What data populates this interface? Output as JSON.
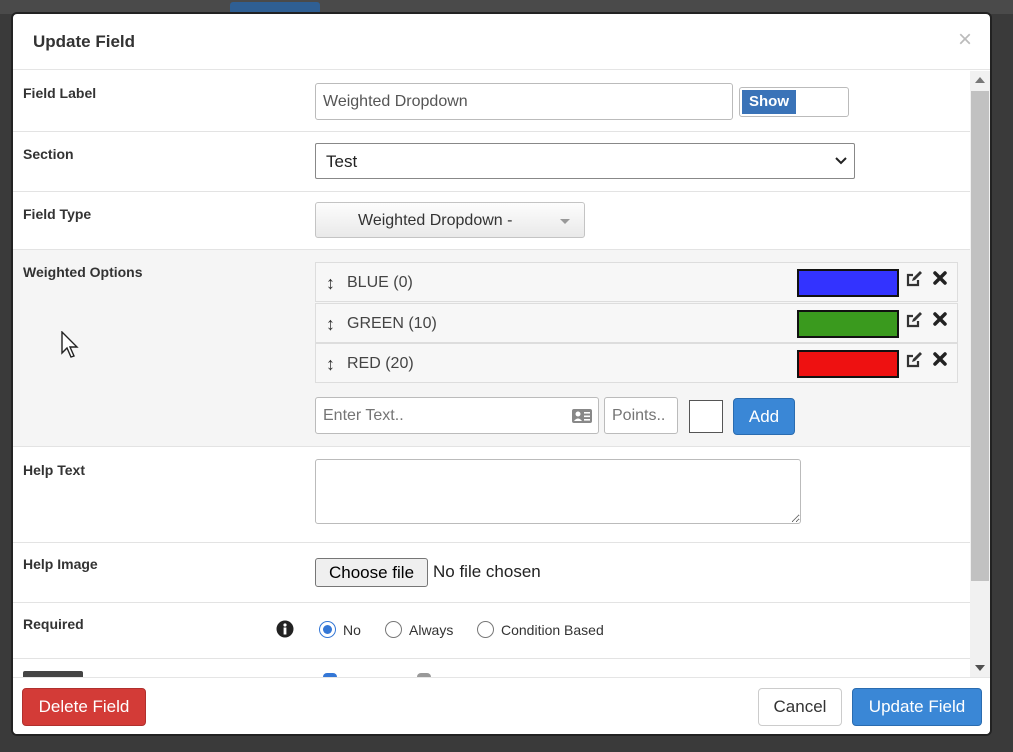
{
  "dialog": {
    "title": "Update Field",
    "close_icon": "×"
  },
  "field_label": {
    "label": "Field Label",
    "value": "Weighted Dropdown",
    "toggle_label": "Show"
  },
  "section": {
    "label": "Section",
    "selected": "Test"
  },
  "field_type": {
    "label": "Field Type",
    "selected": "Weighted Dropdown -"
  },
  "weighted_options": {
    "label": "Weighted Options",
    "items": [
      {
        "label": "BLUE (0)",
        "color": "#3333ff"
      },
      {
        "label": "GREEN (10)",
        "color": "#3a9a1e"
      },
      {
        "label": "RED (20)",
        "color": "#ee1111"
      }
    ],
    "text_placeholder": "Enter Text..",
    "points_placeholder": "Points..",
    "add_label": "Add"
  },
  "help_text": {
    "label": "Help Text"
  },
  "help_image": {
    "label": "Help Image",
    "choose_label": "Choose file",
    "status": "No file chosen"
  },
  "required": {
    "label": "Required",
    "options": [
      "No",
      "Always",
      "Condition Based"
    ],
    "selected": "No"
  },
  "footer": {
    "delete_label": "Delete Field",
    "cancel_label": "Cancel",
    "update_label": "Update Field"
  },
  "colors": {
    "primary": "#3a87d6",
    "danger": "#d33b37",
    "toggle": "#3a73b8"
  }
}
